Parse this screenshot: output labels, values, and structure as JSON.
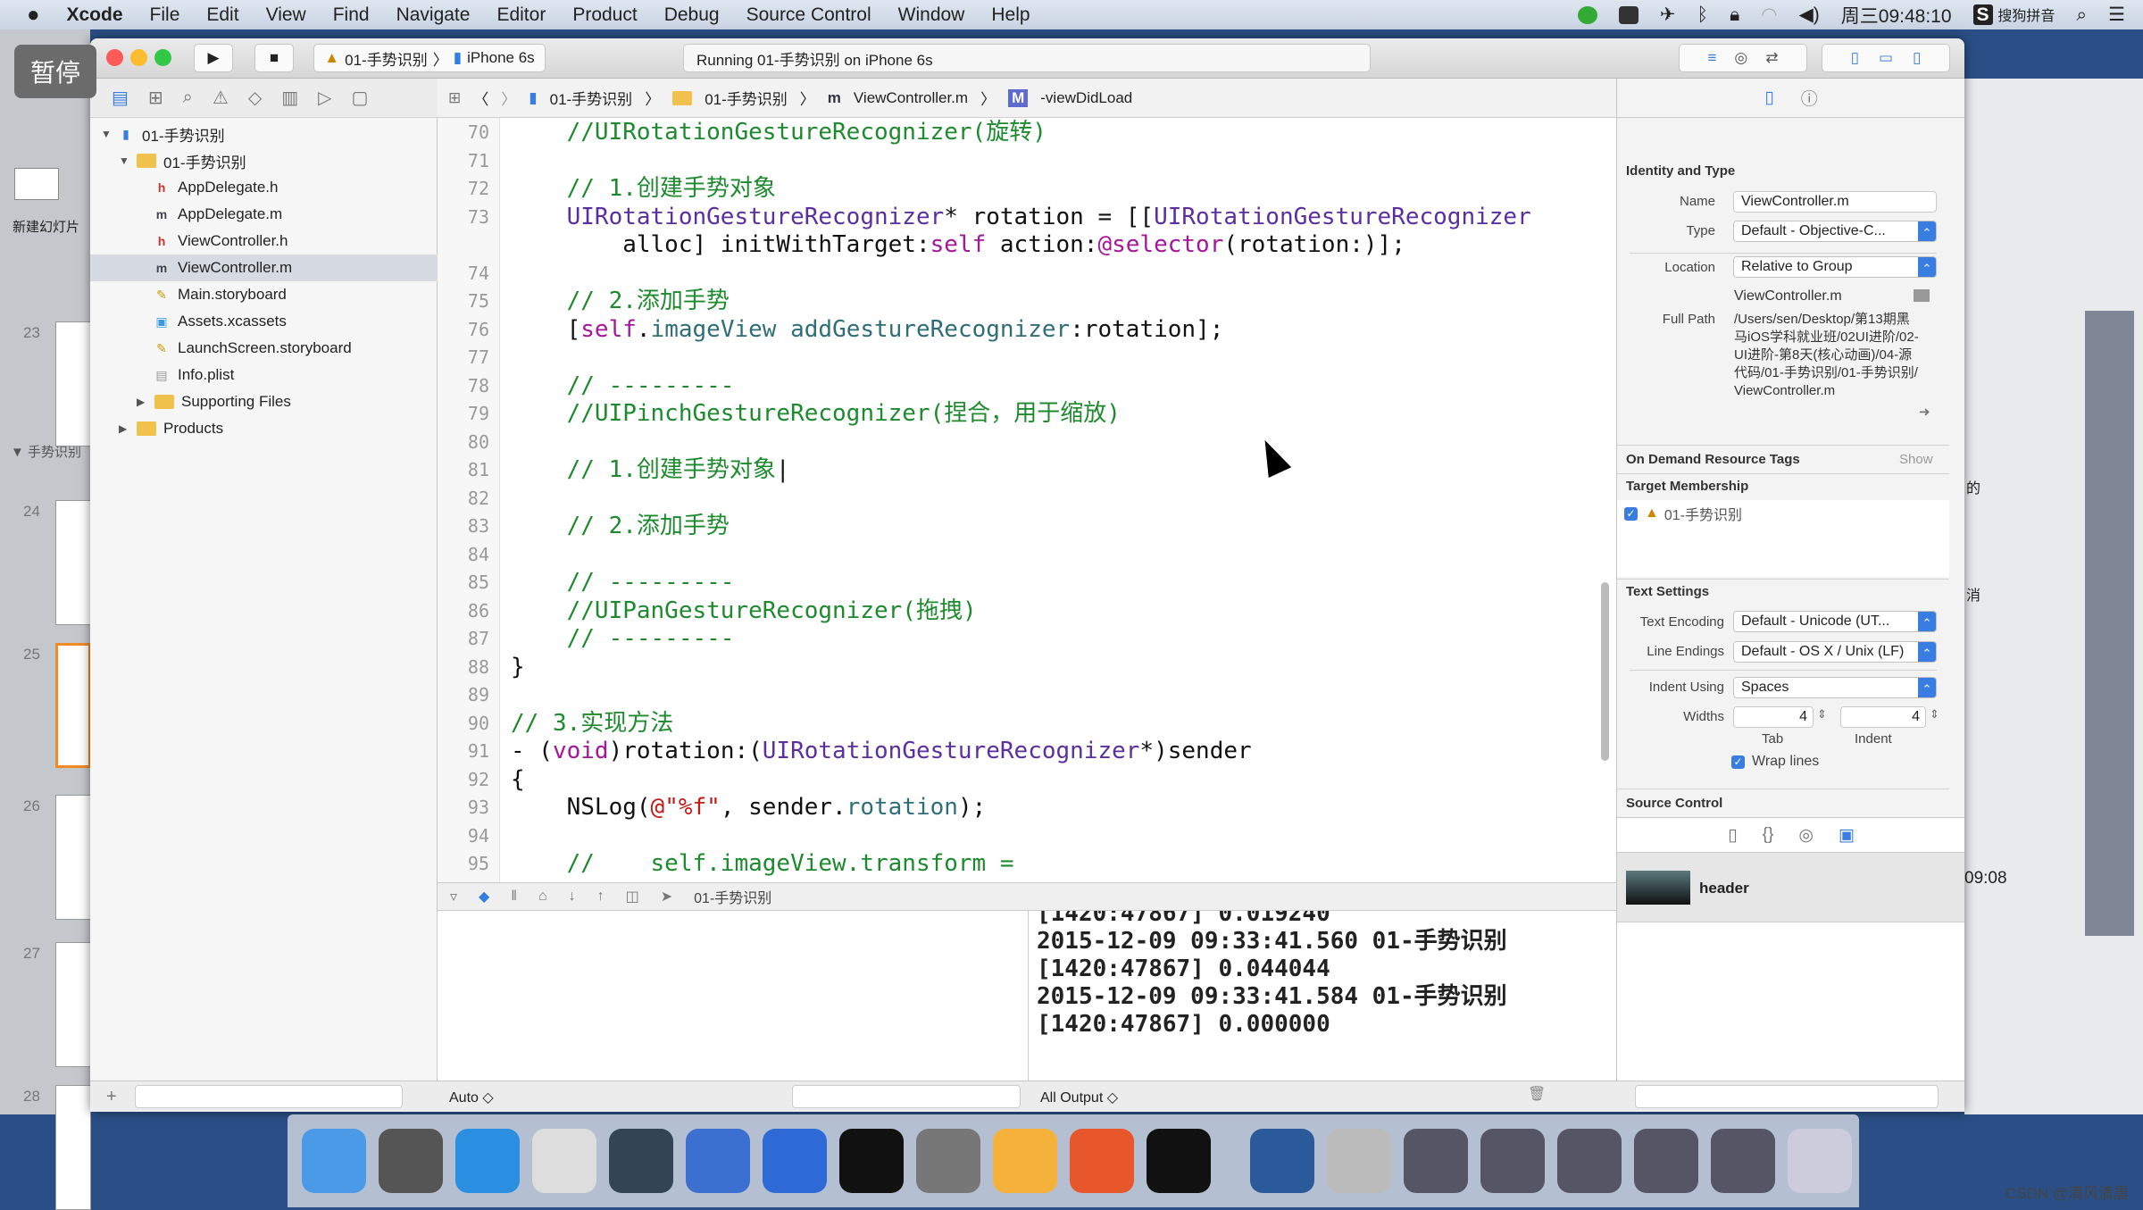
{
  "menubar": {
    "apple_icon": "apple-icon",
    "items": [
      "Xcode",
      "File",
      "Edit",
      "View",
      "Find",
      "Navigate",
      "Editor",
      "Product",
      "Debug",
      "Source Control",
      "Window",
      "Help"
    ],
    "clock": "周三09:48:10",
    "ime": "搜狗拼音"
  },
  "overlay": {
    "pause_label": "暂停"
  },
  "keynote": {
    "new_slide": "新建幻灯片",
    "section": "▼ 手势识别",
    "slides": [
      "23",
      "24",
      "25",
      "26",
      "27",
      "28"
    ]
  },
  "toolbar": {
    "scheme": "01-手势识别",
    "device": "iPhone 6s",
    "status": "Running 01-手势识别 on iPhone 6s"
  },
  "jumpbar": {
    "items": [
      "01-手势识别",
      "01-手势识别",
      "ViewController.m",
      "-viewDidLoad"
    ]
  },
  "navigator": {
    "items": [
      {
        "label": "01-手势识别",
        "type": "project",
        "depth": 0,
        "open": true
      },
      {
        "label": "01-手势识别",
        "type": "folder",
        "depth": 1,
        "open": true
      },
      {
        "label": "AppDelegate.h",
        "type": "h",
        "depth": 2
      },
      {
        "label": "AppDelegate.m",
        "type": "m",
        "depth": 2
      },
      {
        "label": "ViewController.h",
        "type": "h",
        "depth": 2
      },
      {
        "label": "ViewController.m",
        "type": "m",
        "depth": 2,
        "selected": true
      },
      {
        "label": "Main.storyboard",
        "type": "sb",
        "depth": 2
      },
      {
        "label": "Assets.xcassets",
        "type": "assets",
        "depth": 2
      },
      {
        "label": "LaunchScreen.storyboard",
        "type": "sb",
        "depth": 2
      },
      {
        "label": "Info.plist",
        "type": "plist",
        "depth": 2
      },
      {
        "label": "Supporting Files",
        "type": "folder",
        "depth": 2,
        "open": false
      },
      {
        "label": "Products",
        "type": "folder",
        "depth": 1,
        "open": false
      }
    ]
  },
  "code": [
    {
      "n": "70",
      "s": [
        [
          "comment",
          "    //UIRotationGestureRecognizer(旋转)"
        ]
      ]
    },
    {
      "n": "71",
      "s": []
    },
    {
      "n": "72",
      "s": [
        [
          "comment",
          "    // 1.创建手势对象"
        ]
      ]
    },
    {
      "n": "73",
      "s": [
        [
          "cls",
          "    UIRotationGestureRecognizer"
        ],
        [
          "plain",
          "* rotation = [["
        ],
        [
          "cls",
          "UIRotationGestureRecognizer"
        ]
      ],
      "cont": [
        [
          "plain",
          "        alloc] initWithTarget:"
        ],
        [
          "kw",
          "self"
        ],
        [
          "plain",
          " action:"
        ],
        [
          "kw",
          "@selector"
        ],
        [
          "plain",
          "(rotation:)];"
        ]
      ]
    },
    {
      "n": "74",
      "s": []
    },
    {
      "n": "75",
      "s": [
        [
          "comment",
          "    // 2.添加手势"
        ]
      ]
    },
    {
      "n": "76",
      "s": [
        [
          "plain",
          "    ["
        ],
        [
          "kw",
          "self"
        ],
        [
          "plain",
          "."
        ],
        [
          "meth",
          "imageView"
        ],
        [
          "plain",
          " "
        ],
        [
          "meth",
          "addGestureRecognizer"
        ],
        [
          "plain",
          ":rotation];"
        ]
      ]
    },
    {
      "n": "77",
      "s": []
    },
    {
      "n": "78",
      "s": [
        [
          "comment",
          "    // ---------"
        ]
      ]
    },
    {
      "n": "79",
      "s": [
        [
          "comment",
          "    //UIPinchGestureRecognizer(捏合，用于缩放)"
        ]
      ]
    },
    {
      "n": "80",
      "s": []
    },
    {
      "n": "81",
      "s": [
        [
          "comment",
          "    // 1.创建手势对象"
        ],
        [
          "plain",
          "|"
        ]
      ]
    },
    {
      "n": "82",
      "s": []
    },
    {
      "n": "83",
      "s": [
        [
          "comment",
          "    // 2.添加手势"
        ]
      ]
    },
    {
      "n": "84",
      "s": []
    },
    {
      "n": "85",
      "s": [
        [
          "comment",
          "    // ---------"
        ]
      ]
    },
    {
      "n": "86",
      "s": [
        [
          "comment",
          "    //UIPanGestureRecognizer(拖拽)"
        ]
      ]
    },
    {
      "n": "87",
      "s": [
        [
          "comment",
          "    // ---------"
        ]
      ]
    },
    {
      "n": "88",
      "s": [
        [
          "plain",
          "}"
        ]
      ]
    },
    {
      "n": "89",
      "s": []
    },
    {
      "n": "90",
      "s": [
        [
          "comment",
          "// 3.实现方法"
        ]
      ]
    },
    {
      "n": "91",
      "s": [
        [
          "plain",
          "- ("
        ],
        [
          "kw",
          "void"
        ],
        [
          "plain",
          ")rotation:("
        ],
        [
          "cls",
          "UIRotationGestureRecognizer"
        ],
        [
          "plain",
          "*)sender"
        ]
      ]
    },
    {
      "n": "92",
      "s": [
        [
          "plain",
          "{"
        ]
      ]
    },
    {
      "n": "93",
      "s": [
        [
          "plain",
          "    NSLog("
        ],
        [
          "str",
          "@\"%f\""
        ],
        [
          "plain",
          ", sender."
        ],
        [
          "meth",
          "rotation"
        ],
        [
          "plain",
          ");"
        ]
      ]
    },
    {
      "n": "94",
      "s": []
    },
    {
      "n": "95",
      "s": [
        [
          "comment",
          "    //    self.imageView.transform ="
        ]
      ]
    }
  ],
  "debugbar": {
    "target": "01-手势识别"
  },
  "console": {
    "lines": [
      "[1420:47867] 0.019240",
      "2015-12-09 09:33:41.560 01-手势识别",
      "[1420:47867] 0.044044",
      "2015-12-09 09:33:41.584 01-手势识别",
      "[1420:47867] 0.000000"
    ]
  },
  "bottombar": {
    "auto": "Auto ◇",
    "output": "All Output ◇"
  },
  "inspector": {
    "identity": {
      "title": "Identity and Type",
      "name_label": "Name",
      "name": "ViewController.m",
      "type_label": "Type",
      "type": "Default - Objective-C...",
      "location_label": "Location",
      "location": "Relative to Group",
      "filename": "ViewController.m",
      "fullpath_label": "Full Path",
      "fullpath": "/Users/sen/Desktop/第13期黑马iOS学科就业班/02UI进阶/02-UI进阶-第8天(核心动画)/04-源代码/01-手势识别/01-手势识别/ViewController.m"
    },
    "odr": {
      "title": "On Demand Resource Tags",
      "show": "Show"
    },
    "target": {
      "title": "Target Membership",
      "item": "01-手势识别",
      "checked": true
    },
    "text": {
      "title": "Text Settings",
      "enc_label": "Text Encoding",
      "enc": "Default - Unicode (UT...",
      "le_label": "Line Endings",
      "le": "Default - OS X / Unix (LF)",
      "indent_label": "Indent Using",
      "indent": "Spaces",
      "widths_label": "Widths",
      "tab": "4",
      "indentw": "4",
      "tab_label": "Tab",
      "indent_w_label": "Indent",
      "wrap": "Wrap lines",
      "wrap_checked": true
    },
    "sc": {
      "title": "Source Control"
    },
    "library": {
      "item": "header"
    }
  },
  "backdrop": {
    "t1": "的",
    "t2": "消",
    "t3": "09:08"
  },
  "dock": {
    "apps": [
      "finder-icon",
      "launchpad-icon",
      "safari-icon",
      "mouse-icon",
      "imovie-icon",
      "xcode-icon",
      "instruments-icon",
      "terminal-icon",
      "system-preferences-icon",
      "sketch-icon",
      "powerpoint-icon",
      "exec-icon",
      "quicktime-icon",
      "preview-icon",
      "screenshot-icon",
      "screenshot-icon",
      "screenshot-icon",
      "screenshot-icon",
      "screenshot-icon",
      "trash-icon"
    ]
  },
  "watermark": "CSDN @清风清晨"
}
